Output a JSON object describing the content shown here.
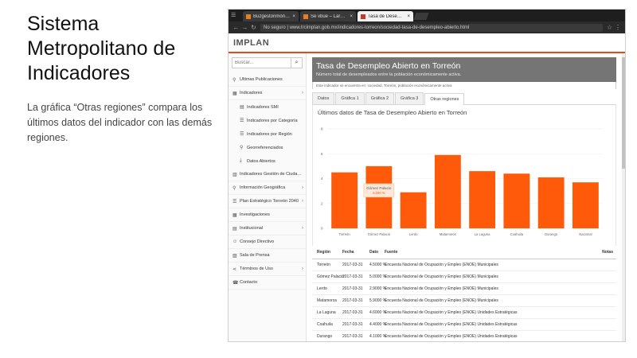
{
  "slide": {
    "title": "Sistema Metropolitano de Indicadores",
    "description": "La gráfica “Otras regiones” compara los últimos datos del indicador con las demás regiones."
  },
  "browser": {
    "tabs": [
      {
        "label": "Buzgestónmónado-CJ... x"
      },
      {
        "label": "Se vbue – Larme Duran..."
      },
      {
        "label": "Tasa de Desempleo A..."
      }
    ],
    "url": "No seguro | www.trcimplan.gob.mx/indicadores-torreon/sociedad-tasa-de-desempleo-abierto.html"
  },
  "site": {
    "logo": "IMPLAN",
    "search_placeholder": "Buscar...",
    "sidebar": [
      {
        "label": "Últimas Publicaciones",
        "icon": "pin-icon",
        "sub": false,
        "chevron": false
      },
      {
        "label": "Indicadores",
        "icon": "grid-icon",
        "sub": false,
        "chevron": true
      },
      {
        "label": "Indicadores SMI",
        "icon": "doc-icon",
        "sub": true,
        "chevron": false
      },
      {
        "label": "Indicadores por Categoría",
        "icon": "list-icon",
        "sub": true,
        "chevron": false
      },
      {
        "label": "Indicadores por Región",
        "icon": "list-icon",
        "sub": true,
        "chevron": false
      },
      {
        "label": "Georreferenciados",
        "icon": "map-marker-icon",
        "sub": true,
        "chevron": false
      },
      {
        "label": "Datos Abiertos",
        "icon": "download-icon",
        "sub": true,
        "chevron": false
      },
      {
        "label": "Indicadores Gestión de Ciudades",
        "icon": "building-icon",
        "sub": false,
        "chevron": false
      },
      {
        "label": "Información Geográfica",
        "icon": "map-marker-icon",
        "sub": false,
        "chevron": true
      },
      {
        "label": "Plan Estratégico Torreón 2040",
        "icon": "list-icon",
        "sub": false,
        "chevron": true
      },
      {
        "label": "Investigaciones",
        "icon": "grid-icon",
        "sub": false,
        "chevron": false
      },
      {
        "label": "Institucional",
        "icon": "doc-icon",
        "sub": false,
        "chevron": true
      },
      {
        "label": "Consejo Directivo",
        "icon": "users-icon",
        "sub": false,
        "chevron": false
      },
      {
        "label": "Sala de Prensa",
        "icon": "news-icon",
        "sub": false,
        "chevron": false
      },
      {
        "label": "Términos de Uso",
        "icon": "share-icon",
        "sub": false,
        "chevron": true
      },
      {
        "label": "Contacto",
        "icon": "phone-icon",
        "sub": false,
        "chevron": false
      }
    ],
    "page_title": "Tasa de Desempleo Abierto en Torreón",
    "page_subtitle": "Número total de desempleados entre la población económicamente activa.",
    "note": "Este indicador se encuentra en: sociedad, Torreón, población económicamente activa",
    "panel_tabs": [
      "Datos",
      "Gráfica 1",
      "Gráfica 2",
      "Gráfica 3",
      "Otras regiones"
    ],
    "active_tab": 4
  },
  "chart_data": {
    "type": "bar",
    "title": "Últimos datos de Tasa de Desempleo Abierto en Torreón",
    "categories": [
      "Torreón",
      "Gómez Palacio",
      "Lerdo",
      "Matamoros",
      "La Laguna",
      "Coahuila",
      "Durango",
      "Nacional"
    ],
    "values": [
      4.5,
      5.0,
      2.9,
      5.9,
      4.6,
      4.4,
      4.1,
      3.7
    ],
    "ylim": [
      0,
      8
    ],
    "yticks": [
      0,
      2,
      4,
      6,
      8
    ],
    "highlight": {
      "label": "Gómez Palacio",
      "value_text": "5.000 %"
    },
    "bar_color": "#ff5a0a"
  },
  "table": {
    "headers": [
      "Región",
      "Fecha",
      "Dato",
      "Fuente",
      "Notas"
    ],
    "rows": [
      [
        "Torreón",
        "2017-03-31",
        "4.5000 %",
        "Encuesta Nacional de Ocupación y Empleo (ENOE) Municipales",
        ""
      ],
      [
        "Gómez Palacio",
        "2017-03-31",
        "5.0000 %",
        "Encuesta Nacional de Ocupación y Empleo (ENOE) Municipales",
        ""
      ],
      [
        "Lerdo",
        "2017-03-31",
        "2.9000 %",
        "Encuesta Nacional de Ocupación y Empleo (ENOE) Municipales",
        ""
      ],
      [
        "Matamoros",
        "2017-03-31",
        "5.9000 %",
        "Encuesta Nacional de Ocupación y Empleo (ENOE) Municipales",
        ""
      ],
      [
        "La Laguna",
        "2017-03-31",
        "4.6000 %",
        "Encuesta Nacional de Ocupación y Empleo (ENOE) Unidades Estratégicas",
        ""
      ],
      [
        "Coahuila",
        "2017-03-31",
        "4.4000 %",
        "Encuesta Nacional de Ocupación y Empleo (ENOE) Unidades Estratégicas",
        ""
      ],
      [
        "Durango",
        "2017-03-31",
        "4.1000 %",
        "Encuesta Nacional de Ocupación y Empleo (ENOE) Unidades Estratégicas",
        ""
      ]
    ]
  }
}
